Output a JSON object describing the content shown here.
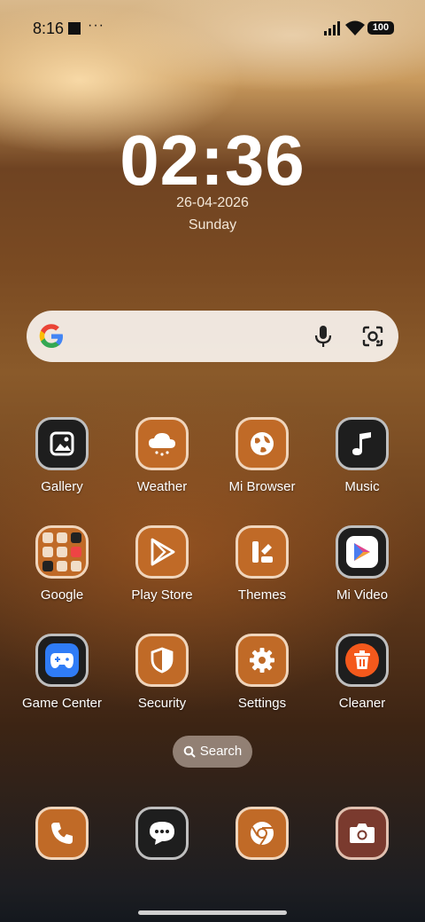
{
  "status_bar": {
    "time": "8:16",
    "overflow": "···",
    "battery": "100",
    "icons": [
      "stop-square-icon",
      "signal-icon",
      "wifi-icon",
      "battery-icon"
    ]
  },
  "clock": {
    "time": "02:36",
    "date": "26-04-2026",
    "day": "Sunday"
  },
  "search_bar": {
    "icons": [
      "google-logo-icon",
      "microphone-icon",
      "lens-camera-icon"
    ]
  },
  "apps": [
    {
      "label": "Gallery",
      "icon": "gallery-icon"
    },
    {
      "label": "Weather",
      "icon": "cloud-icon"
    },
    {
      "label": "Mi Browser",
      "icon": "globe-icon"
    },
    {
      "label": "Music",
      "icon": "music-note-icon"
    },
    {
      "label": "Google",
      "icon": "folder-icon"
    },
    {
      "label": "Play Store",
      "icon": "play-store-icon"
    },
    {
      "label": "Themes",
      "icon": "themes-icon"
    },
    {
      "label": "Mi Video",
      "icon": "video-play-icon"
    },
    {
      "label": "Game Center",
      "icon": "gamepad-icon"
    },
    {
      "label": "Security",
      "icon": "shield-icon"
    },
    {
      "label": "Settings",
      "icon": "gear-icon"
    },
    {
      "label": "Cleaner",
      "icon": "trash-icon"
    }
  ],
  "app_drawer_search": {
    "label": "Search",
    "icon": "search-icon"
  },
  "dock": [
    {
      "name": "phone",
      "icon": "phone-icon"
    },
    {
      "name": "messages",
      "icon": "chat-bubble-icon"
    },
    {
      "name": "chrome",
      "icon": "chrome-icon"
    },
    {
      "name": "camera",
      "icon": "camera-icon"
    }
  ],
  "colors": {
    "icon_orange": "#c06a27",
    "icon_dark": "#1e1e1e",
    "icon_maroon": "#7a3a2e",
    "search_bar_bg": "#f8f3ee"
  }
}
